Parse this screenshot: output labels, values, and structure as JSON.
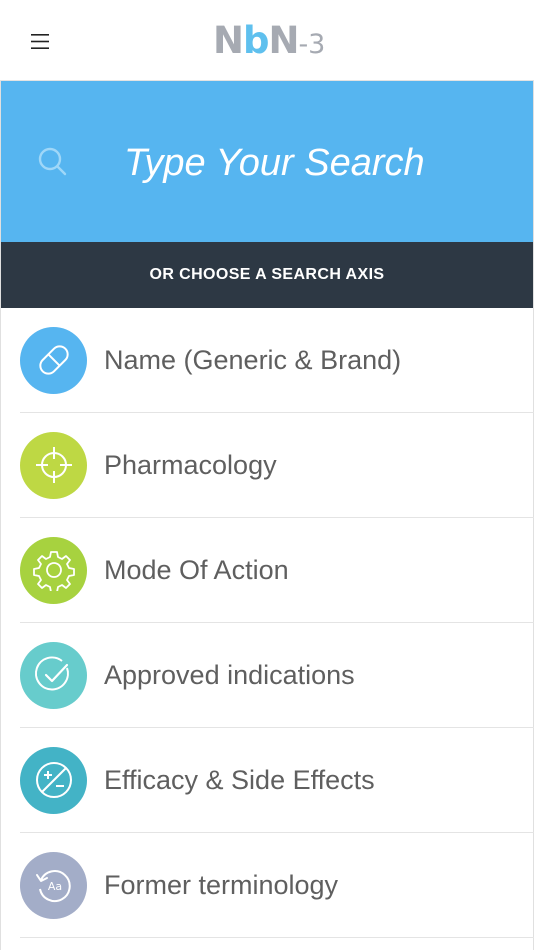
{
  "header": {
    "logo": {
      "part1": "N",
      "part2": "b",
      "part3": "N",
      "suffix": "-3"
    },
    "menu_icon": "hamburger-icon"
  },
  "search": {
    "placeholder": "Type Your Search",
    "icon": "search-icon"
  },
  "axis_header": {
    "label": "OR CHOOSE A SEARCH AXIS"
  },
  "axes": [
    {
      "label": "Name (Generic & Brand)",
      "icon": "pill-icon",
      "color": "#56b5f0"
    },
    {
      "label": "Pharmacology",
      "icon": "crosshair-icon",
      "color": "#bed844"
    },
    {
      "label": "Mode Of Action",
      "icon": "gear-icon",
      "color": "#a7d23f"
    },
    {
      "label": "Approved indications",
      "icon": "check-circle-icon",
      "color": "#67cccc"
    },
    {
      "label": "Efficacy & Side Effects",
      "icon": "plus-minus-icon",
      "color": "#43b3c6"
    },
    {
      "label": "Former terminology",
      "icon": "history-text-icon",
      "color": "#a3adc8"
    }
  ],
  "colors": {
    "search_panel": "#56b5f0",
    "axis_bar": "#2d3844",
    "logo_gray": "#a6aab2",
    "logo_blue": "#5fc0ee"
  }
}
